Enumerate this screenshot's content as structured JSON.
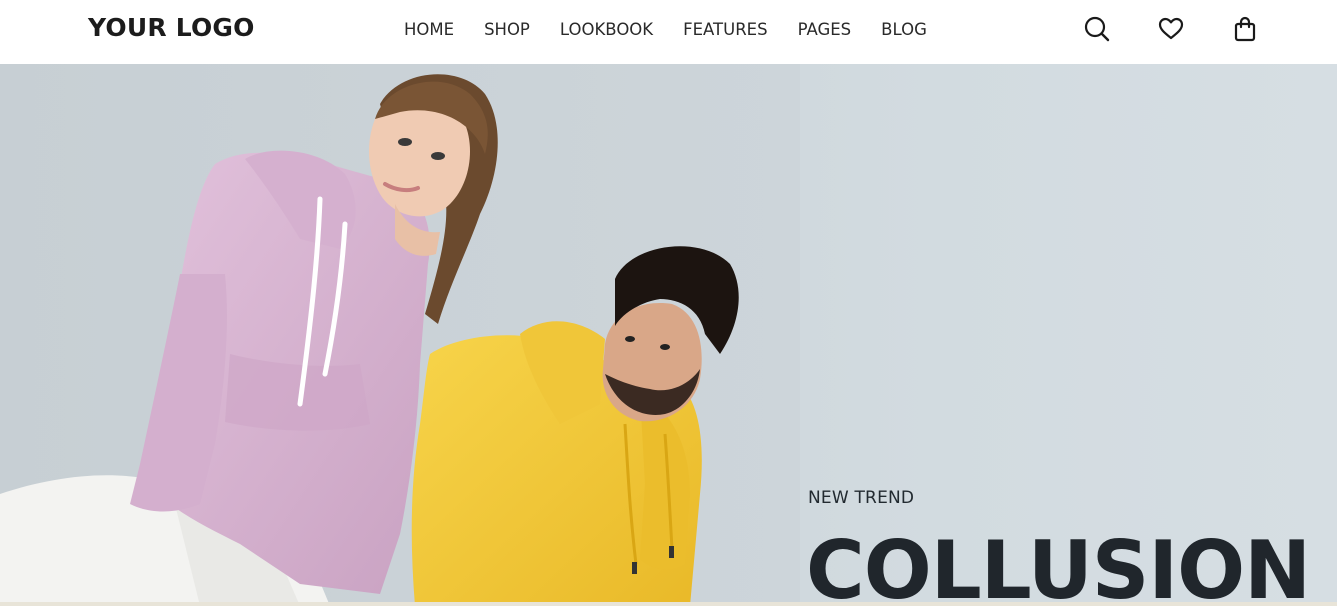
{
  "header": {
    "logo_text": "YOUR LOGO",
    "nav": [
      {
        "label": "HOME"
      },
      {
        "label": "SHOP"
      },
      {
        "label": "LOOKBOOK"
      },
      {
        "label": "FEATURES"
      },
      {
        "label": "PAGES"
      },
      {
        "label": "BLOG"
      }
    ],
    "icons": [
      "search-icon",
      "heart-icon",
      "shopping-bag-icon"
    ]
  },
  "hero": {
    "subtitle": "NEW TREND",
    "title": "COLLUSION",
    "image": "woman-in-pink-hoodie-and-man-in-yellow-hoodie",
    "colors": {
      "background": "#ccd4d9",
      "text": "#20262c",
      "pink_hoodie": "#dcb8d6",
      "yellow_hoodie": "#f4cc3a"
    }
  }
}
